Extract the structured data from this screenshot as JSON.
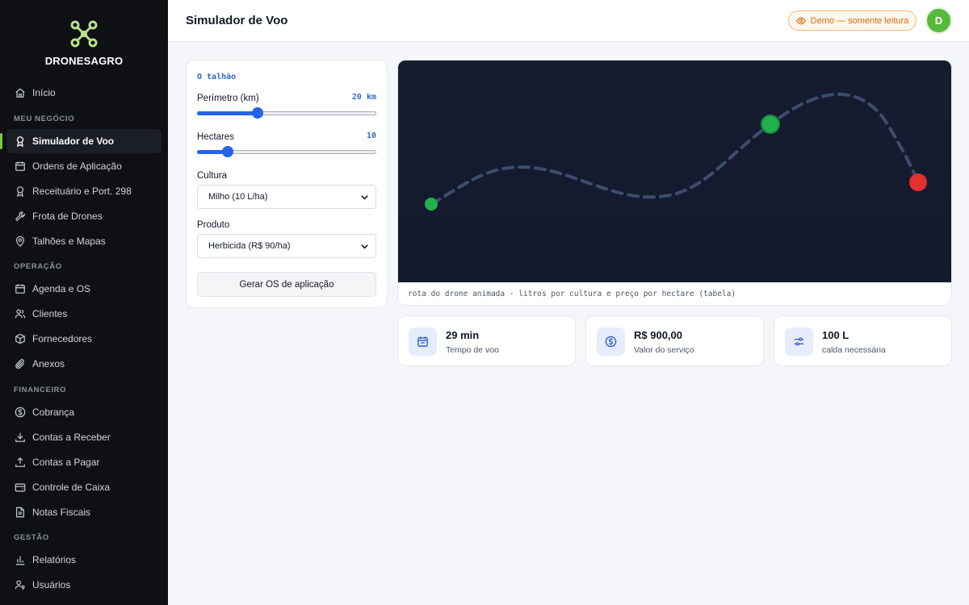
{
  "brand": {
    "name": "DRONESAGRO"
  },
  "sidebar": {
    "inicio": "Início",
    "sections": {
      "meu_negocio": "MEU NEGÓCIO",
      "operacao": "OPERAÇÃO",
      "financeiro": "FINANCEIRO",
      "gestao": "GESTÃO"
    },
    "items": {
      "simulador": "Simulador de Voo",
      "ordens": "Ordens de Aplicação",
      "receituario": "Receituário e Port. 298",
      "frota": "Frota de Drones",
      "talhoes": "Talhões e Mapas",
      "agenda": "Agenda e OS",
      "clientes": "Clientes",
      "fornecedores": "Fornecedores",
      "anexos": "Anexos",
      "cobranca": "Cobrança",
      "receber": "Contas a Receber",
      "pagar": "Contas a Pagar",
      "caixa": "Controle de Caixa",
      "notas": "Notas Fiscais",
      "relatorios": "Relatórios",
      "usuarios": "Usuários"
    },
    "active": "simulador"
  },
  "header": {
    "title": "Simulador de Voo",
    "demo_badge": "Demo — somente leitura",
    "avatar_initial": "D"
  },
  "simulator": {
    "heading": "O talhão",
    "perimetro": {
      "label": "Perímetro (km)",
      "value_text": "20 km",
      "fraction": 0.34
    },
    "hectares": {
      "label": "Hectares",
      "value_text": "10",
      "fraction": 0.17
    },
    "cultura": {
      "label": "Cultura",
      "selected": "Milho (10 L/ha)"
    },
    "produto": {
      "label": "Produto",
      "selected": "Herbicida (R$ 90/ha)"
    },
    "generate_button": "Gerar OS de aplicação"
  },
  "map": {
    "caption": "rota do drone animada · litros por cultura e preço por hectare (tabela)",
    "background": "#131a2e",
    "route_color": "#3d4d6e",
    "start_color": "#22b14c",
    "drone_color": "#22b14c",
    "end_color": "#e53030"
  },
  "stats": [
    {
      "icon": "calendar-icon",
      "value": "29 min",
      "label": "Tempo de voo"
    },
    {
      "icon": "dollar-icon",
      "value": "R$ 900,00",
      "label": "Valor do serviço"
    },
    {
      "icon": "sliders-icon",
      "value": "100 L",
      "label": "calda necessária"
    }
  ],
  "colors": {
    "accent": "#2563eb",
    "sidebar_bg": "#0e1014",
    "active_indicator": "#7ac943",
    "demo_badge": "#d86a10",
    "avatar": "#56b93b"
  }
}
